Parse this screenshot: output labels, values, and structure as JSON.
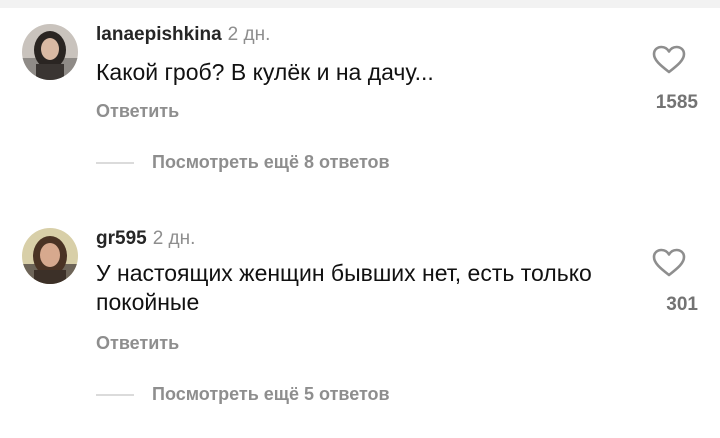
{
  "comments": [
    {
      "username": "lanaepishkina",
      "time": "2 дн.",
      "text": "Какой гроб? В кулёк и на дачу...",
      "reply_label": "Ответить",
      "likes": "1585",
      "view_replies": "Посмотреть ещё 8 ответов",
      "avatar_icon": "user-avatar"
    },
    {
      "username": "gr595",
      "time": "2 дн.",
      "text": "У настоящих женщин бывших нет, есть только покойные",
      "reply_label": "Ответить",
      "likes": "301",
      "view_replies": "Посмотреть ещё 5 ответов",
      "avatar_icon": "user-avatar"
    }
  ],
  "icons": {
    "like": "heart-outline-icon"
  },
  "colors": {
    "secondary_text": "#8e8e8e",
    "primary_text": "#111111",
    "divider": "#dbdbdb"
  }
}
